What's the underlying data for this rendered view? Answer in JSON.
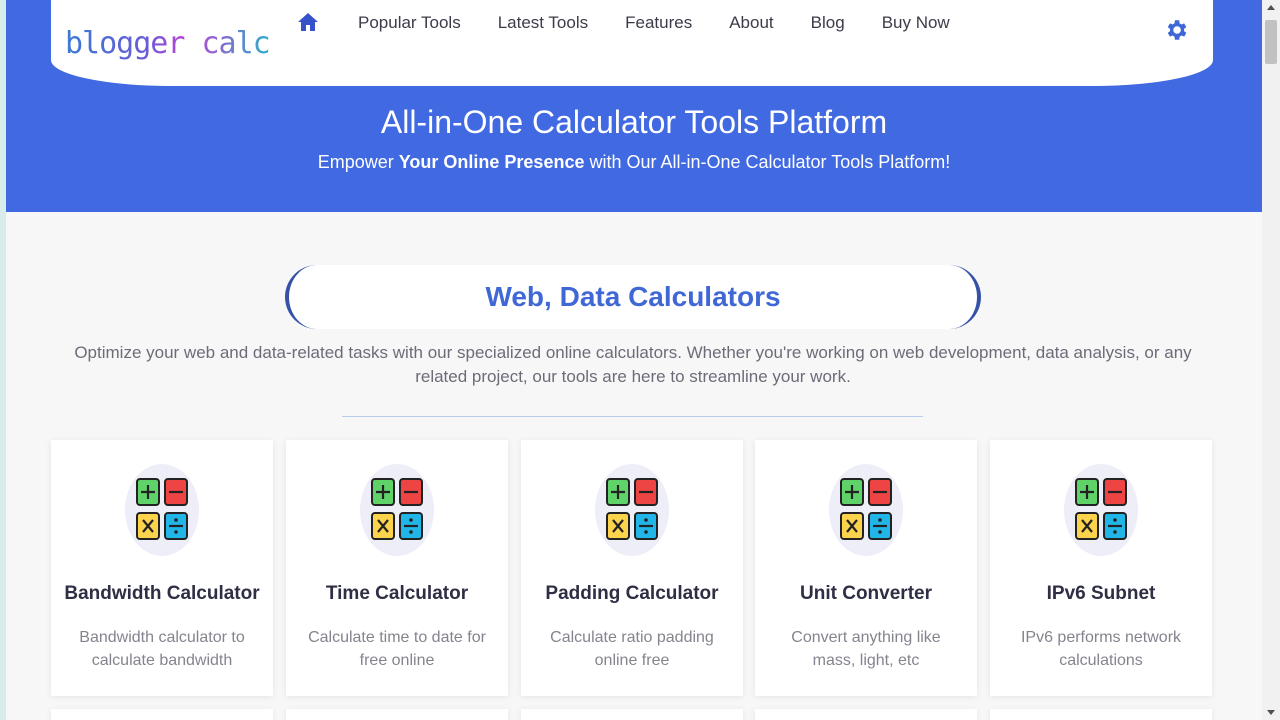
{
  "header": {
    "logo_text": "blogger calc",
    "nav": [
      "Popular Tools",
      "Latest Tools",
      "Features",
      "About",
      "Blog",
      "Buy Now"
    ]
  },
  "hero": {
    "title": "All-in-One Calculator Tools Platform",
    "subtitle_pre": "Empower ",
    "subtitle_bold": "Your Online Presence",
    "subtitle_post": " with Our All-in-One Calculator Tools Platform!"
  },
  "section": {
    "heading": "Web, Data Calculators",
    "description": "Optimize your web and data-related tasks with our specialized online calculators. Whether you're working on web development, data analysis, or any related project, our tools are here to streamline your work."
  },
  "cards": [
    {
      "title": "Bandwidth Calculator",
      "desc": "Bandwidth calculator to calculate bandwidth"
    },
    {
      "title": "Time Calculator",
      "desc": "Calculate time to date for free online"
    },
    {
      "title": "Padding Calculator",
      "desc": "Calculate ratio padding online free"
    },
    {
      "title": "Unit Converter",
      "desc": "Convert anything like mass, light, etc"
    },
    {
      "title": "IPv6 Subnet",
      "desc": "IPv6 performs network calculations"
    }
  ],
  "colors": {
    "brand_blue": "#4169e1",
    "heading_blue": "#3f67d6"
  },
  "icons": [
    "home-icon",
    "gear-icon",
    "calculator-icon"
  ]
}
